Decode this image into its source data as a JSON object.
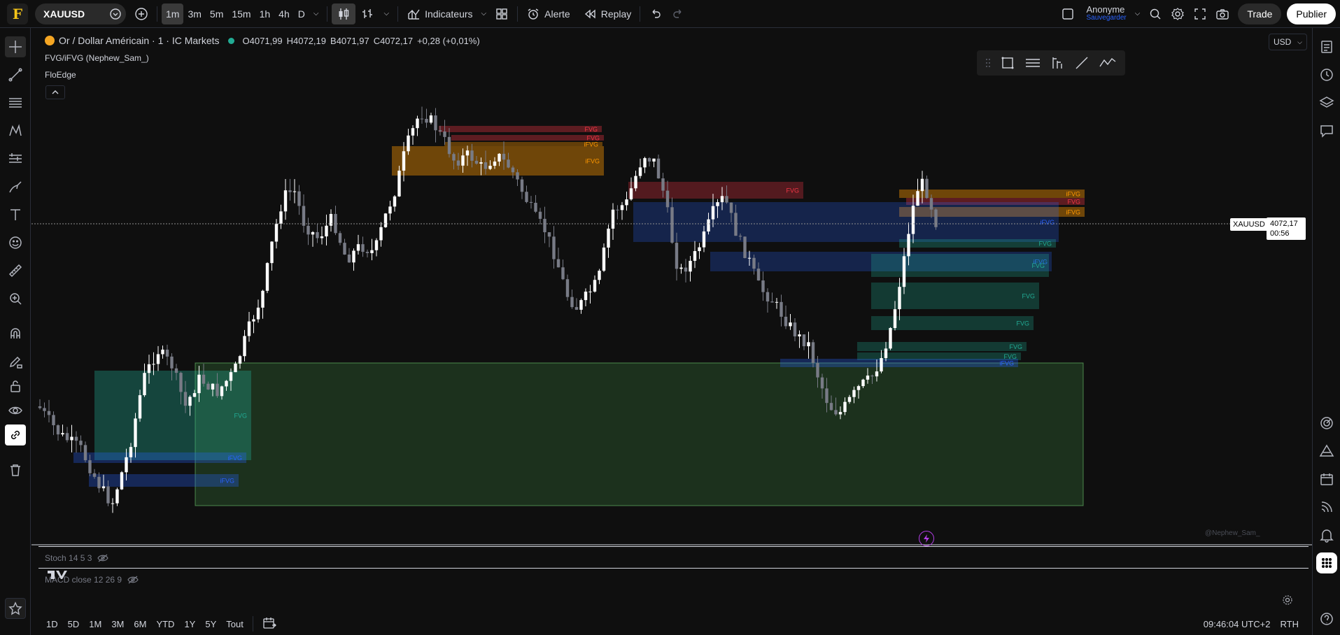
{
  "topbar": {
    "logo": "F",
    "symbol": "XAUUSD",
    "timeframes": [
      "1m",
      "3m",
      "5m",
      "15m",
      "1h",
      "4h",
      "D"
    ],
    "active_timeframe": "1m",
    "indicators_label": "Indicateurs",
    "alert_label": "Alerte",
    "replay_label": "Replay",
    "user_name": "Anonyme",
    "save_label": "Sauvegarder",
    "trade_label": "Trade",
    "publish_label": "Publier"
  },
  "legend": {
    "title": "Or / Dollar Américain · 1 · IC Markets",
    "open_label": "O",
    "open": "4071,99",
    "high_label": "H",
    "high": "4072,19",
    "low_label": "B",
    "low": "4071,97",
    "close_label": "C",
    "close": "4072,17",
    "change": "+0,28 (+0,01%)",
    "indicator1": "FVG/iFVG (Nephew_Sam_)",
    "indicator2": "FloEdge"
  },
  "price_axis": {
    "currency": "USD",
    "price_tag_symbol": "XAUUSD",
    "price_tag_value": "4072,17",
    "price_tag_countdown": "00:56"
  },
  "watermark": "@Nephew_Sam_",
  "subpanes": {
    "stoch": "Stoch 14 5 3",
    "macd": "MACD close 12 26 9"
  },
  "bottombar": {
    "ranges": [
      "1D",
      "5D",
      "1M",
      "3M",
      "6M",
      "YTD",
      "1Y",
      "5Y",
      "Tout"
    ],
    "time": "09:46:04 UTC+2",
    "session": "RTH"
  },
  "zones": [
    {
      "label": "FVG",
      "color": "#f23645"
    },
    {
      "label": "FVG",
      "color": "#f23645"
    },
    {
      "label": "iFVG",
      "color": "#ff9800"
    },
    {
      "label": "iFVG",
      "color": "#ff9800"
    },
    {
      "label": "FVG",
      "color": "#f23645"
    },
    {
      "label": "iFVG",
      "color": "#ff9800"
    },
    {
      "label": "FVG",
      "color": "#f23645"
    },
    {
      "label": "iFVG",
      "color": "#ff9800"
    },
    {
      "label": "iFVG",
      "color": "#2962ff"
    },
    {
      "label": "FVG",
      "color": "#22ab94"
    },
    {
      "label": "iFVG",
      "color": "#2962ff"
    },
    {
      "label": "FVG",
      "color": "#22ab94"
    },
    {
      "label": "FVG",
      "color": "#22ab94"
    },
    {
      "label": "FVG",
      "color": "#22ab94"
    },
    {
      "label": "FVG",
      "color": "#22ab94"
    },
    {
      "label": "FVG",
      "color": "#22ab94"
    },
    {
      "label": "iFVG",
      "color": "#2962ff"
    },
    {
      "label": "FVG",
      "color": "#22ab94"
    },
    {
      "label": "iFVG",
      "color": "#2962ff"
    },
    {
      "label": "iFVG",
      "color": "#2962ff"
    }
  ],
  "colors": {
    "accent": "#2962ff",
    "bull": "#ffffff",
    "bear": "#787b86",
    "bg": "#0f0f0f"
  }
}
